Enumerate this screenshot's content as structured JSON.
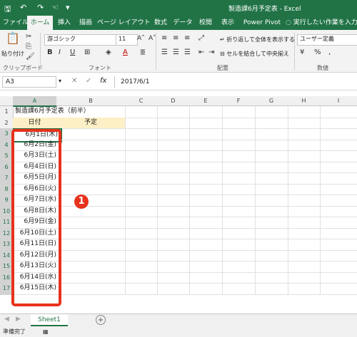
{
  "titlebar": {
    "title": "製造課6月予定表 - Excel"
  },
  "tabs": [
    "ファイル",
    "ホーム",
    "挿入",
    "描画",
    "ページ レイアウト",
    "数式",
    "データ",
    "校閲",
    "表示",
    "Power Pivot",
    "実行したい作業を入力"
  ],
  "ribbon": {
    "paste_label": "貼り付け",
    "font_name": "游ゴシック",
    "font_size": "11",
    "wrap_label": "折り返して全体を表示する",
    "merge_label": "セルを結合して中央揃え",
    "number_format": "ユーザー定義",
    "groups": [
      "クリップボード",
      "フォント",
      "配置",
      "数値"
    ]
  },
  "formula_bar": {
    "name_box": "A3",
    "fx": "fx",
    "value": "2017/6/1"
  },
  "sheet": {
    "columns": [
      "A",
      "B",
      "C",
      "D",
      "E",
      "F",
      "G",
      "H",
      "I"
    ],
    "rows": [
      "1",
      "2",
      "3",
      "4",
      "5",
      "6",
      "7",
      "8",
      "9",
      "10",
      "11",
      "12",
      "13",
      "14",
      "15",
      "16",
      "17"
    ],
    "a1": "製造課6月予定表（前半）",
    "header_date": "日付",
    "header_plan": "予定",
    "dates": [
      "6月1日(木)",
      "6月2日(金)",
      "6月3日(土)",
      "6月4日(日)",
      "6月5日(月)",
      "6月6日(火)",
      "6月7日(水)",
      "6月8日(木)",
      "6月9日(金)",
      "6月10日(土)",
      "6月11日(日)",
      "6月12日(月)",
      "6月13日(火)",
      "6月14日(水)",
      "6月15日(木)"
    ],
    "header_color": "#fdf0c6"
  },
  "annotation": {
    "marker": "1",
    "color": "#e8321c"
  },
  "sheet_tabs": {
    "active": "Sheet1",
    "add": "+"
  },
  "status": {
    "text": "準備完了"
  }
}
